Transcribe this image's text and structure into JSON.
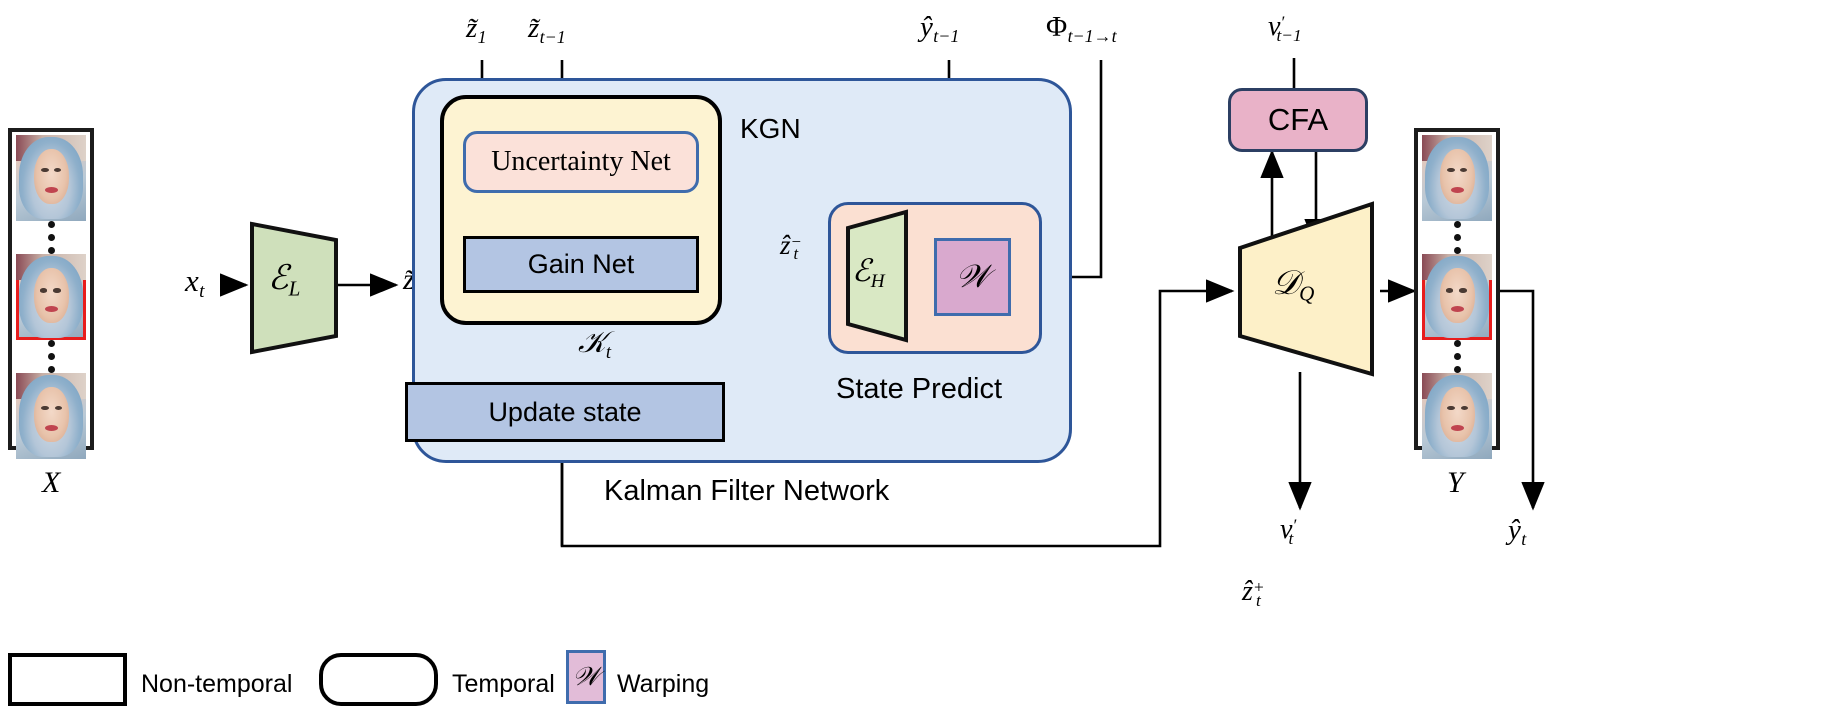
{
  "diagram": {
    "title": "Kalman Filter Network video face restoration pipeline",
    "colors": {
      "kfn_fill": "#dfeaf7",
      "kfn_border": "#2e5699",
      "kgn_fill": "#fdf3d2",
      "kgn_border": "#000000",
      "uncertainty_fill": "#fbe1d9",
      "gain_fill": "#b3c5e3",
      "update_fill": "#b3c5e3",
      "state_predict_fill": "#fbe0d2",
      "encoder_low_fill": "#cfe0bb",
      "encoder_high_fill": "#d9e8c4",
      "warp_fill": "#d9a9ce",
      "cfa_fill": "#e9b2c8",
      "decoder_fill": "#fdf0c8",
      "selected_frame": "#e81d1d"
    }
  },
  "inputs": {
    "stack_label": "X",
    "encoder_low_label": "ℰ",
    "encoder_low_sub": "L",
    "x_t_label": "x",
    "x_t_sub": "t",
    "z_tilde_t": "z̃",
    "z_tilde_t_sub": "t"
  },
  "kgn": {
    "name": "KGN",
    "top_inputs": [
      {
        "base": "z̃",
        "sub": "1"
      },
      {
        "base": "z̃",
        "sub": "t−1"
      }
    ],
    "uncertainty_net": "Uncertainty Net",
    "gain_net": "Gain Net",
    "gain_output": {
      "base": "𝒦",
      "sub": "t"
    }
  },
  "kalman": {
    "name": "Kalman Filter Network",
    "update_state": "Update state",
    "posterior_label": {
      "base": "ẑ",
      "sub": "t",
      "sup": "+"
    }
  },
  "state_predict": {
    "name": "State Predict",
    "encoder_high_label": "ℰ",
    "encoder_high_sub": "H",
    "warping_symbol": "𝒲",
    "prior_label": {
      "base": "ẑ",
      "sub": "t",
      "sup": "−"
    },
    "inputs": [
      {
        "base": "ŷ",
        "sub": "t−1"
      },
      {
        "base": "Φ",
        "sub": "t−1→t"
      }
    ]
  },
  "decoder": {
    "cfa_label": "CFA",
    "cfa_input": {
      "base": "v",
      "sub": "t−1",
      "sup": "′"
    },
    "cfa_output": {
      "base": "v",
      "sub": "t",
      "sup": "′"
    },
    "decoder_label": "𝒟",
    "decoder_sub": "Q"
  },
  "outputs": {
    "stack_label": "Y",
    "y_hat_t": {
      "base": "ŷ",
      "sub": "t"
    }
  },
  "legend": {
    "items": [
      {
        "shape": "rect",
        "label": "Non-temporal"
      },
      {
        "shape": "round",
        "label": "Temporal"
      },
      {
        "shape": "warp",
        "label": "Warping",
        "symbol": "𝒲"
      }
    ]
  }
}
